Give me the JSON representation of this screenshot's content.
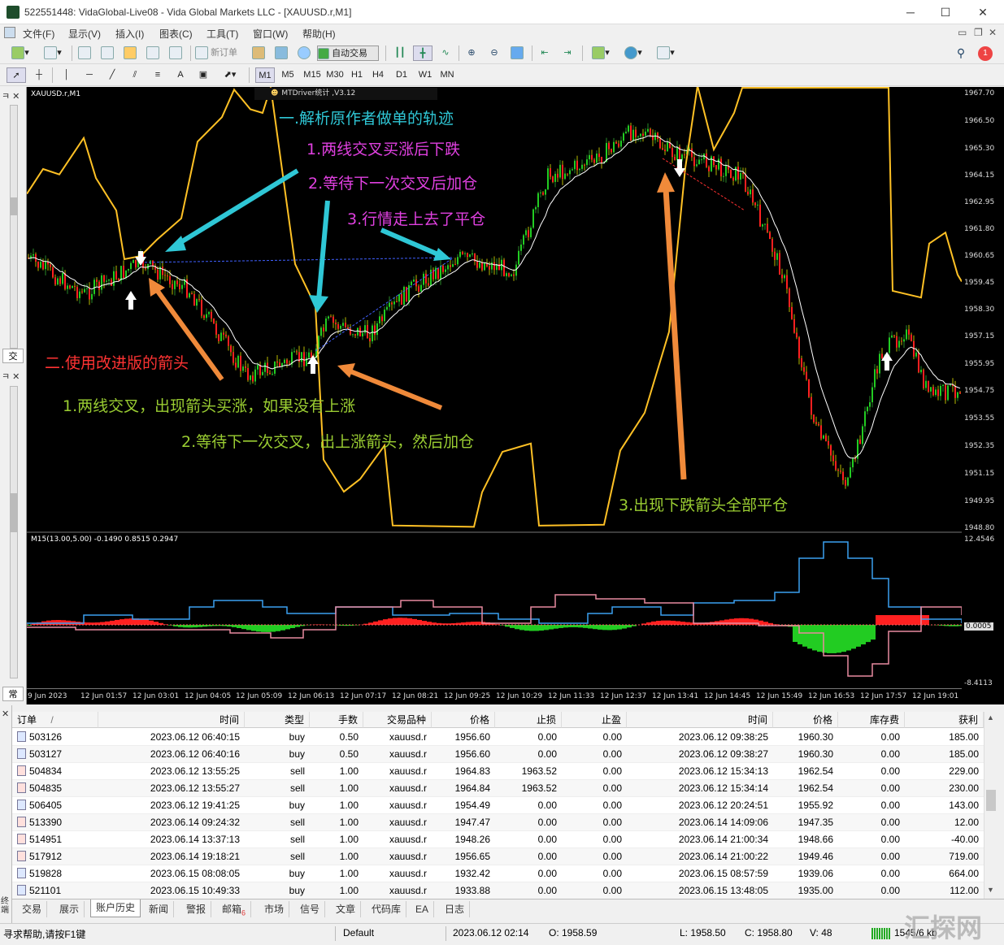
{
  "window": {
    "title": "522551448: VidaGlobal-Live08 - Vida Global Markets LLC - [XAUUSD.r,M1]",
    "minimize": "─",
    "maximize": "☐",
    "close": "✕"
  },
  "menu": [
    "文件(F)",
    "显示(V)",
    "插入(I)",
    "图表(C)",
    "工具(T)",
    "窗口(W)",
    "帮助(H)"
  ],
  "toolbar": {
    "new_order": "新订单",
    "auto_trade": "自动交易"
  },
  "timeframes": [
    "M1",
    "M5",
    "M15",
    "M30",
    "H1",
    "H4",
    "D1",
    "W1",
    "MN"
  ],
  "chart": {
    "symbol_label": "XAUUSD.r,M1",
    "ea_label": "MTDriver统计 ,V3.12",
    "indicator_label": "M15(13.00,5.00) -0.1490 0.8515 0.2947",
    "price_ticks": [
      "1967.70",
      "1966.50",
      "1965.30",
      "1964.15",
      "1962.95",
      "1961.80",
      "1960.65",
      "1959.45",
      "1958.30",
      "1957.15",
      "1955.95",
      "1954.75",
      "1953.55",
      "1952.35",
      "1951.15",
      "1949.95",
      "1948.80"
    ],
    "ind_ticks": [
      "12.4546",
      "0.0005",
      "-8.4113"
    ],
    "time_ticks": [
      "9 Jun 2023",
      "12 Jun 01:57",
      "12 Jun 03:01",
      "12 Jun 04:05",
      "12 Jun 05:09",
      "12 Jun 06:13",
      "12 Jun 07:17",
      "12 Jun 08:21",
      "12 Jun 09:25",
      "12 Jun 10:29",
      "12 Jun 11:33",
      "12 Jun 12:37",
      "12 Jun 13:41",
      "12 Jun 14:45",
      "12 Jun 15:49",
      "12 Jun 16:53",
      "12 Jun 17:57",
      "12 Jun 19:01"
    ],
    "annotations": {
      "a1": "一.解析原作者做单的轨迹",
      "a2": "1.两线交叉买涨后下跌",
      "a3": "2.等待下一次交叉后加仓",
      "a4": "3.行情走上去了平仓",
      "a5": "二.使用改进版的箭头",
      "a6": "1.两线交叉，出现箭头买涨，如果没有上涨",
      "a7": "2.等待下一次交叉，出上涨箭头，然后加仓",
      "a8": "3.出现下跌箭头全部平仓"
    },
    "colors": {
      "bg": "#000000",
      "yellow": "#ffc125",
      "cyan": "#2fc7d6",
      "orange": "#f08a3a",
      "magenta": "#e040e0",
      "green_text": "#9acd32",
      "red_text": "#ff3333",
      "blue_line": "#3aa0f0",
      "pink_line": "#e88aa0"
    }
  },
  "left_tabs": {
    "top": "交",
    "bottom": "常"
  },
  "table": {
    "headers": [
      "订单",
      "时间",
      "类型",
      "手数",
      "交易品种",
      "价格",
      "止损",
      "止盈",
      "时间",
      "价格",
      "库存费",
      "获利"
    ],
    "sort_mark": "/",
    "rows": [
      [
        "503126",
        "2023.06.12 06:40:15",
        "buy",
        "0.50",
        "xauusd.r",
        "1956.60",
        "0.00",
        "0.00",
        "2023.06.12 09:38:25",
        "1960.30",
        "0.00",
        "185.00"
      ],
      [
        "503127",
        "2023.06.12 06:40:16",
        "buy",
        "0.50",
        "xauusd.r",
        "1956.60",
        "0.00",
        "0.00",
        "2023.06.12 09:38:27",
        "1960.30",
        "0.00",
        "185.00"
      ],
      [
        "504834",
        "2023.06.12 13:55:25",
        "sell",
        "1.00",
        "xauusd.r",
        "1964.83",
        "1963.52",
        "0.00",
        "2023.06.12 15:34:13",
        "1962.54",
        "0.00",
        "229.00"
      ],
      [
        "504835",
        "2023.06.12 13:55:27",
        "sell",
        "1.00",
        "xauusd.r",
        "1964.84",
        "1963.52",
        "0.00",
        "2023.06.12 15:34:14",
        "1962.54",
        "0.00",
        "230.00"
      ],
      [
        "506405",
        "2023.06.12 19:41:25",
        "buy",
        "1.00",
        "xauusd.r",
        "1954.49",
        "0.00",
        "0.00",
        "2023.06.12 20:24:51",
        "1955.92",
        "0.00",
        "143.00"
      ],
      [
        "513390",
        "2023.06.14 09:24:32",
        "sell",
        "1.00",
        "xauusd.r",
        "1947.47",
        "0.00",
        "0.00",
        "2023.06.14 14:09:06",
        "1947.35",
        "0.00",
        "12.00"
      ],
      [
        "514951",
        "2023.06.14 13:37:13",
        "sell",
        "1.00",
        "xauusd.r",
        "1948.26",
        "0.00",
        "0.00",
        "2023.06.14 21:00:34",
        "1948.66",
        "0.00",
        "-40.00"
      ],
      [
        "517912",
        "2023.06.14 19:18:21",
        "sell",
        "1.00",
        "xauusd.r",
        "1956.65",
        "0.00",
        "0.00",
        "2023.06.14 21:00:22",
        "1949.46",
        "0.00",
        "719.00"
      ],
      [
        "519828",
        "2023.06.15 08:08:05",
        "buy",
        "1.00",
        "xauusd.r",
        "1932.42",
        "0.00",
        "0.00",
        "2023.06.15 08:57:59",
        "1939.06",
        "0.00",
        "664.00"
      ],
      [
        "521101",
        "2023.06.15 10:49:33",
        "buy",
        "1.00",
        "xauusd.r",
        "1933.88",
        "0.00",
        "0.00",
        "2023.06.15 13:48:05",
        "1935.00",
        "0.00",
        "112.00"
      ]
    ]
  },
  "bottom_tabs": [
    "交易",
    "展示",
    "账户历史",
    "新闻",
    "警报",
    "邮箱",
    "市场",
    "信号",
    "文章",
    "代码库",
    "EA",
    "日志"
  ],
  "mail_badge": "6",
  "side_label": "终端",
  "status": {
    "help": "寻求帮助,请按F1键",
    "profile": "Default",
    "datetime": "2023.06.12 02:14",
    "open": "O: 1958.59",
    "low": "L: 1958.50",
    "close": "C: 1958.80",
    "volume": "V: 48",
    "traffic": "1545/6 kb"
  },
  "watermark": "汇探网"
}
